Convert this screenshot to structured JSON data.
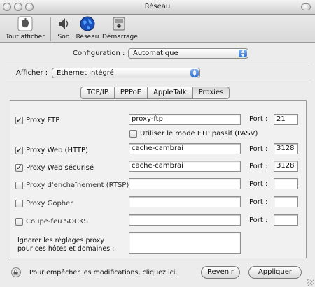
{
  "window": {
    "title": "Réseau"
  },
  "toolbar": {
    "items": [
      {
        "label": "Tout afficher",
        "icon": "apple-grid-icon"
      },
      {
        "label": "Son",
        "icon": "speaker-icon"
      },
      {
        "label": "Réseau",
        "icon": "globe-icon"
      },
      {
        "label": "Démarrage",
        "icon": "disk-icon"
      }
    ]
  },
  "configuration": {
    "label": "Configuration :",
    "value": "Automatique"
  },
  "afficher": {
    "label": "Afficher :",
    "value": "Ethernet intégré"
  },
  "tabs": [
    {
      "label": "TCP/IP",
      "active": false
    },
    {
      "label": "PPPoE",
      "active": false
    },
    {
      "label": "AppleTalk",
      "active": false
    },
    {
      "label": "Proxies",
      "active": true
    }
  ],
  "proxies": {
    "port_label": "Port :",
    "rows": [
      {
        "label": "Proxy FTP",
        "checked": true,
        "host": "proxy-ftp",
        "port": "21"
      },
      {
        "label": "Proxy Web (HTTP)",
        "checked": true,
        "host": "cache-cambrai",
        "port": "3128"
      },
      {
        "label": "Proxy Web sécurisé",
        "checked": true,
        "host": "cache-cambrai",
        "port": "3128"
      },
      {
        "label": "Proxy d'enchaînement (RTSP)",
        "checked": false,
        "host": "",
        "port": ""
      },
      {
        "label": "Proxy Gopher",
        "checked": false,
        "host": "",
        "port": ""
      },
      {
        "label": "Coupe-feu SOCKS",
        "checked": false,
        "host": "",
        "port": ""
      }
    ],
    "passive_ftp": {
      "label": "Utiliser le mode FTP passif (PASV)",
      "checked": false
    },
    "bypass": {
      "label_line1": "Ignorer les réglages proxy",
      "label_line2": "pour ces hôtes et domaines :",
      "value": ""
    }
  },
  "footer": {
    "lock_text": "Pour empêcher les modifications, cliquez ici.",
    "revert_label": "Revenir",
    "apply_label": "Appliquer"
  },
  "colors": {
    "accent": "#2f6fd1",
    "window_bg": "#ececec"
  }
}
